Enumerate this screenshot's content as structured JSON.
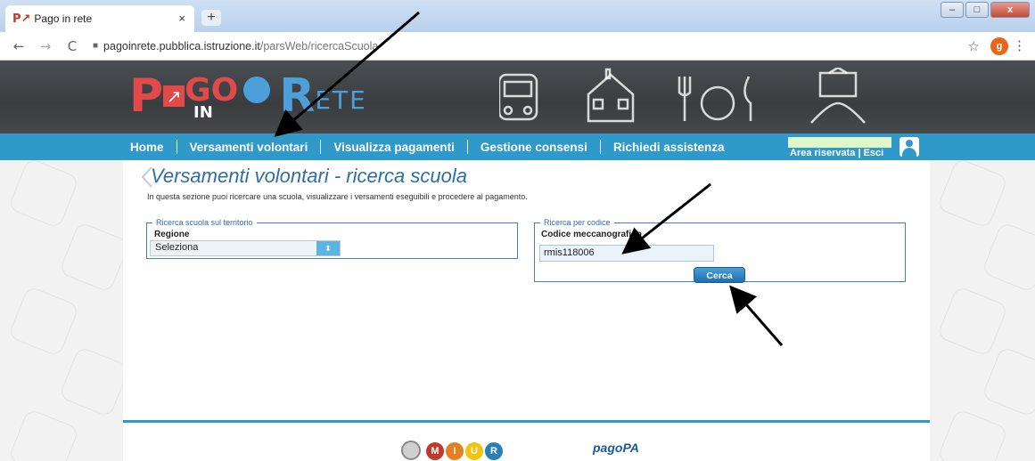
{
  "browser": {
    "tab_title": "Pago in rete",
    "tab_favicon": "P↗",
    "tab_close": "×",
    "new_tab": "+",
    "url_host": "pagoinrete.pubblica.istruzione.it",
    "url_path": "/parsWeb/ricercaScuola",
    "profile_initial": "g",
    "win_minimize": "–",
    "win_maximize": "□",
    "win_close": "x"
  },
  "header": {
    "logo_p": "P",
    "logo_go": "GO",
    "logo_in": "IN",
    "logo_r": "R",
    "logo_ete": "ETE"
  },
  "nav": {
    "items": [
      "Home",
      "Versamenti volontari",
      "Visualizza pagamenti",
      "Gestione consensi",
      "Richiedi assistenza"
    ],
    "area_riservata": "Area riservata | Esci"
  },
  "main": {
    "title": "Versamenti volontari - ricerca scuola",
    "subtitle": "In questa sezione puoi ricercare una scuola, visualizzare i versamenti eseguibili e procedere al pagamento.",
    "territorio": {
      "legend": "Ricerca scuola sul territorio",
      "regione_label": "Regione",
      "regione_value": "Seleziona",
      "arrows": "⬍"
    },
    "codice": {
      "legend": "Ricerca per codice",
      "label": "Codice meccanografico",
      "value": "rmis118006",
      "button": "Cerca"
    }
  },
  "footer": {
    "miur_letters": [
      "M",
      "I",
      "U",
      "R"
    ],
    "pagopa": "pagoPA"
  },
  "colors": {
    "nav": "#2f9ac9",
    "title": "#2f6ea4",
    "button": "#1f6fae"
  }
}
